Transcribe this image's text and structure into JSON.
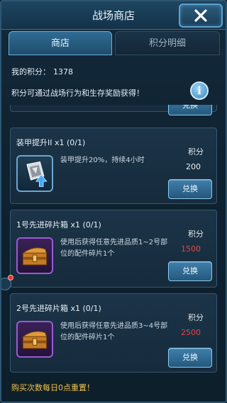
{
  "header": {
    "title": "战场商店",
    "close_icon": "close-icon"
  },
  "tabs": [
    {
      "label": "商店",
      "active": true
    },
    {
      "label": "积分明细",
      "active": false
    }
  ],
  "points": {
    "label": "我的积分：",
    "value": "1378"
  },
  "info": {
    "text": "积分可通过战场行为和生存奖励获得！",
    "icon": "info-icon",
    "icon_glyph": "i"
  },
  "items": [
    {
      "name": "装甲提升II x1 (0/1)",
      "icon": "armor-upgrade-icon",
      "description": "装甲提升20%，持续4小时",
      "score_label": "积分",
      "score": "200",
      "button": "兑换"
    },
    {
      "name": "1号先进碎片箱 x1 (0/1)",
      "icon": "chest-icon",
      "description": "使用后获得任意先进品质1~2号部位的配件碎片1个",
      "score_label": "积分",
      "score": "1500",
      "button": "兑换"
    },
    {
      "name": "2号先进碎片箱 x1 (0/1)",
      "icon": "chest-icon",
      "description": "使用后获得任意先进品质3~4号部位的配件碎片1个",
      "score_label": "积分",
      "score": "2500",
      "button": "兑换"
    }
  ],
  "partial_button": "兑换",
  "footer": "购买次数每日0点重置！",
  "colors": {
    "accent": "#5aa2cf",
    "unaffordable": "#e04848",
    "footer": "#f0c24a"
  }
}
